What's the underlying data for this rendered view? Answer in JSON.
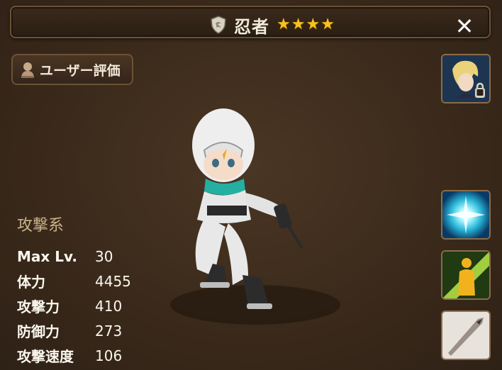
{
  "title": {
    "monster_name": "忍者",
    "stars": [
      "★",
      "★",
      "★",
      "★"
    ],
    "element_icon": "wind-element-icon",
    "close_icon": "close-icon",
    "close_label": "✕"
  },
  "user_eval_button": {
    "label": "ユーザー評価",
    "icon": "user-bust-icon"
  },
  "right_slots": [
    {
      "name": "awakened-form-portrait",
      "locked": true
    },
    {
      "name": "skill-1-icon"
    },
    {
      "name": "skill-2-icon"
    },
    {
      "name": "skill-3-icon"
    }
  ],
  "stats": {
    "category": "攻撃系",
    "rows": [
      {
        "label": "Max Lv.",
        "value": "30"
      },
      {
        "label": "体力",
        "value": "4455"
      },
      {
        "label": "攻撃力",
        "value": "410"
      },
      {
        "label": "防御力",
        "value": "273"
      },
      {
        "label": "攻撃速度",
        "value": "106"
      }
    ]
  },
  "colors": {
    "accent_gold": "#f7c21e",
    "frame_brown": "#6b5136",
    "category_tan": "#c9b28a"
  }
}
